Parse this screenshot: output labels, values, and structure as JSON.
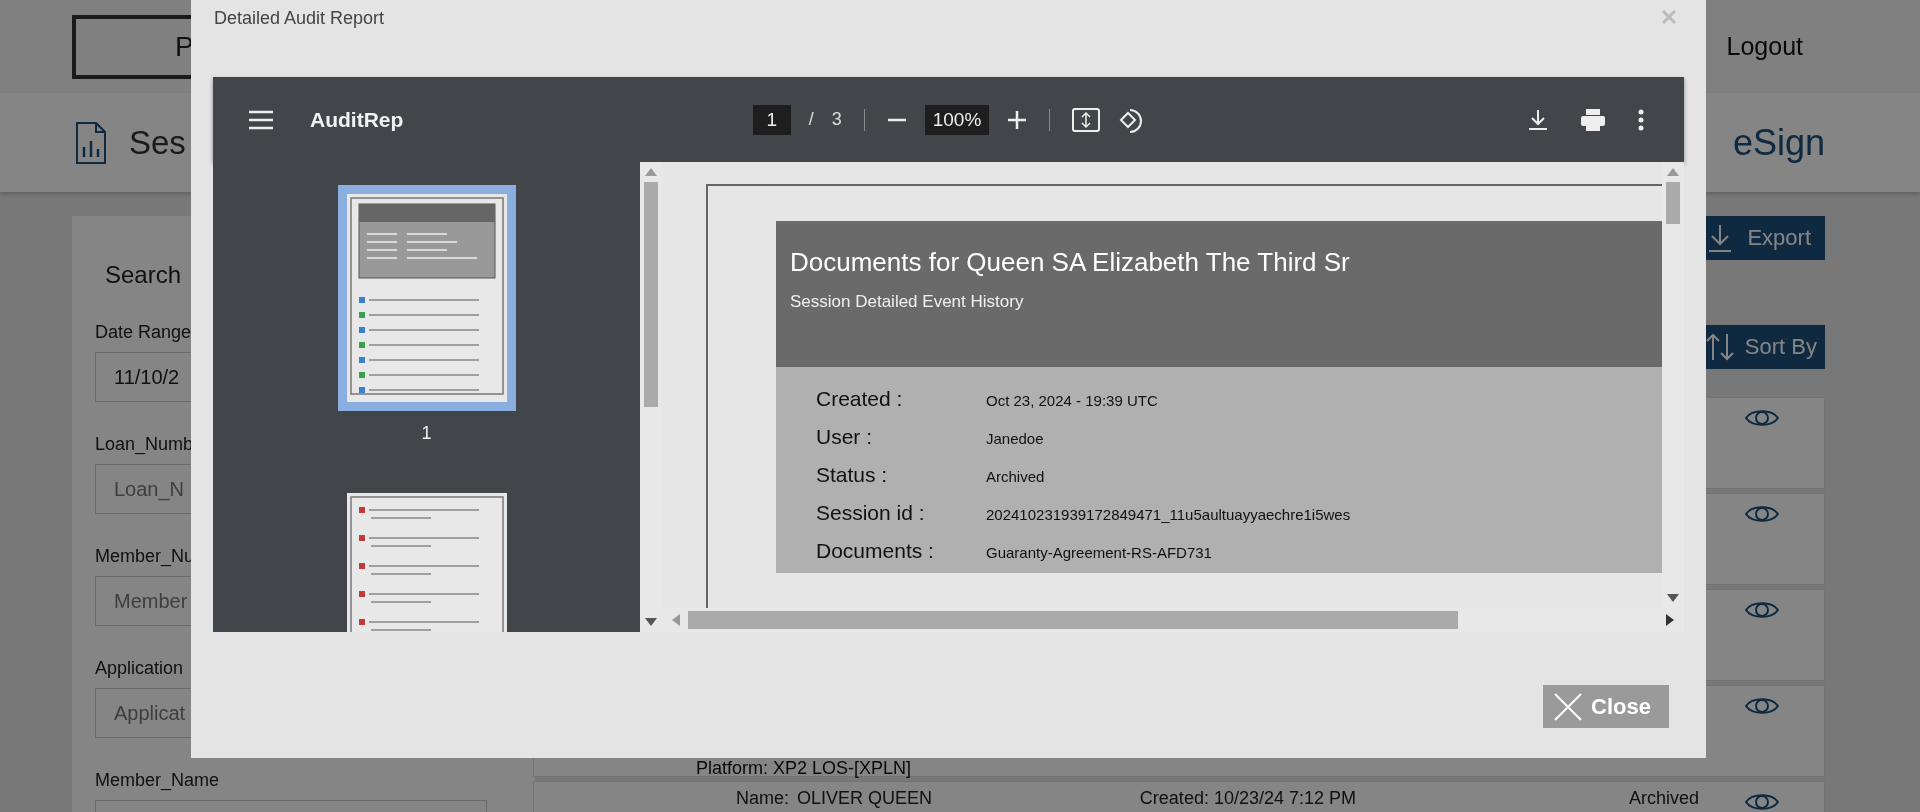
{
  "header": {
    "logo": "P",
    "nav": [
      "Logout"
    ]
  },
  "subheader": {
    "title": "Ses",
    "product": "eSign"
  },
  "search": {
    "title": "Search",
    "fields": [
      {
        "label": "Date Range",
        "value": "11/10/2"
      },
      {
        "label": "Loan_Numb",
        "placeholder": "Loan_N"
      },
      {
        "label": "Member_Nu",
        "placeholder": "Member"
      },
      {
        "label": "Application",
        "placeholder": "Applicat"
      },
      {
        "label": "Member_Name"
      }
    ]
  },
  "export_button": "Export",
  "sort_button": "Sort By",
  "sessions": [
    {
      "kind": "session"
    },
    {
      "kind": "session"
    },
    {
      "kind": "session"
    },
    {
      "kind": "session",
      "platform": "Platform: XP2 LOS-[XPLN]"
    },
    {
      "kind": "session",
      "name_label": "Name:",
      "name": "OLIVER QUEEN",
      "created": "Created: 10/23/24 7:12 PM",
      "status": "Archived"
    }
  ],
  "modal": {
    "title": "Detailed Audit Report",
    "close_button": "Close",
    "viewer": {
      "file_name": "AuditRep",
      "page": "1",
      "page_separator": "/",
      "page_total": "3",
      "zoom": "100%",
      "thumbnails": [
        {
          "label": "1",
          "selected": true
        },
        {
          "selected": false
        }
      ],
      "document": {
        "title": "Documents for Queen SA Elizabeth The Third Sr",
        "subtitle": "Session Detailed Event History",
        "fields": [
          {
            "label": "Created :",
            "value": "Oct 23, 2024 - 19:39  UTC"
          },
          {
            "label": "User :",
            "value": "Janedoe"
          },
          {
            "label": "Status :",
            "value": "Archived"
          },
          {
            "label": "Session id :",
            "value": "202410231939172849471_11u5aultuayyaechre1i5wes"
          },
          {
            "label": "Documents :",
            "value": "Guaranty-Agreement-RS-AFD731"
          }
        ]
      }
    }
  }
}
